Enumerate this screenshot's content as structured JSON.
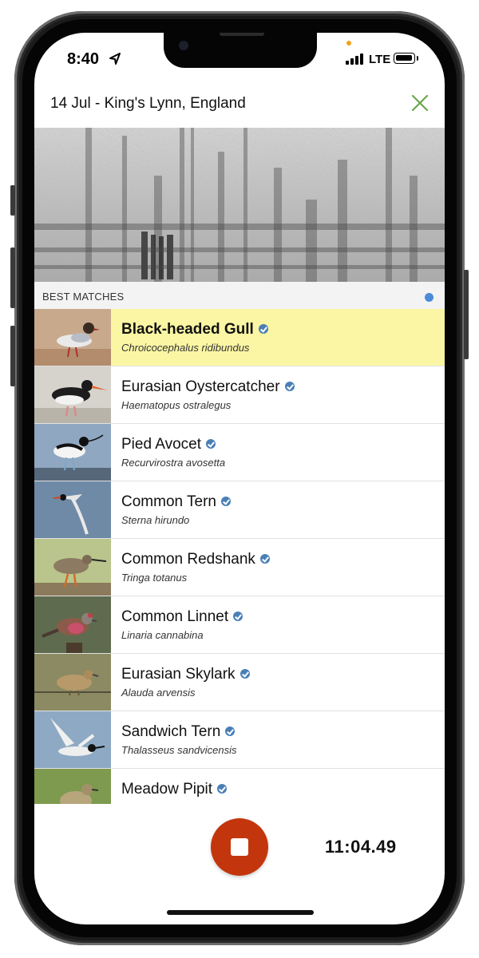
{
  "status_bar": {
    "time": "8:40",
    "network": "LTE",
    "icons": [
      "location-arrow-icon",
      "cellular-signal-icon",
      "battery-icon"
    ]
  },
  "header": {
    "title": "14 Jul - King's Lynn, England",
    "close_icon": "close-icon",
    "accent_color": "#6aa84f"
  },
  "spectrogram": {
    "icon": "spectrogram-image"
  },
  "matches": {
    "section_label": "BEST MATCHES",
    "indicator_color": "#4a8ad8",
    "items": [
      {
        "common": "Black-headed Gull",
        "scientific": "Chroicocephalus ridibundus",
        "highlighted": true
      },
      {
        "common": "Eurasian Oystercatcher",
        "scientific": "Haematopus ostralegus"
      },
      {
        "common": "Pied Avocet",
        "scientific": "Recurvirostra avosetta"
      },
      {
        "common": "Common Tern",
        "scientific": "Sterna hirundo"
      },
      {
        "common": "Common Redshank",
        "scientific": "Tringa totanus"
      },
      {
        "common": "Common Linnet",
        "scientific": "Linaria cannabina"
      },
      {
        "common": "Eurasian Skylark",
        "scientific": "Alauda arvensis"
      },
      {
        "common": "Sandwich Tern",
        "scientific": "Thalasseus sandvicensis"
      },
      {
        "common": "Meadow Pipit",
        "scientific": ""
      }
    ]
  },
  "controls": {
    "stop_icon": "stop-icon",
    "stop_color": "#c3360d",
    "timer": "11:04.49"
  }
}
